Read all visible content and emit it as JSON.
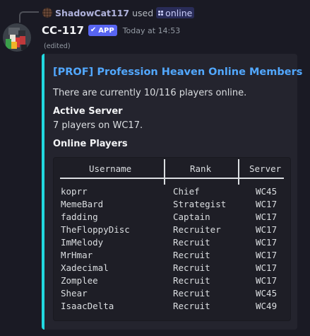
{
  "reply": {
    "username": "ShadowCat117",
    "used_text": "used",
    "command": "online"
  },
  "message": {
    "author": "CC-117",
    "badge": "APP",
    "timestamp": "Today at 14:53",
    "edited": "(edited)"
  },
  "embed": {
    "accent_color": "#22d9e0",
    "title": "[PROF] Profession Heaven Online Members",
    "description": "There are currently 10/116 players online.",
    "active_server_label": "Active Server",
    "active_server_value": "7 players on WC17.",
    "online_players_label": "Online Players",
    "table": {
      "headers": [
        "Username",
        "Rank",
        "Server"
      ],
      "rows": [
        [
          "koprr",
          "Chief",
          "WC45"
        ],
        [
          "MemeBard",
          "Strategist",
          "WC17"
        ],
        [
          "fadding",
          "Captain",
          "WC17"
        ],
        [
          "TheFloppyDisc",
          "Recruiter",
          "WC17"
        ],
        [
          "ImMelody",
          "Recruit",
          "WC17"
        ],
        [
          "MrHmar",
          "Recruit",
          "WC17"
        ],
        [
          "Xadecimal",
          "Recruit",
          "WC17"
        ],
        [
          "Zomplee",
          "Recruit",
          "WC17"
        ],
        [
          "Shear",
          "Recruit",
          "WC45"
        ],
        [
          "IsaacDelta",
          "Recruit",
          "WC49"
        ]
      ]
    }
  }
}
